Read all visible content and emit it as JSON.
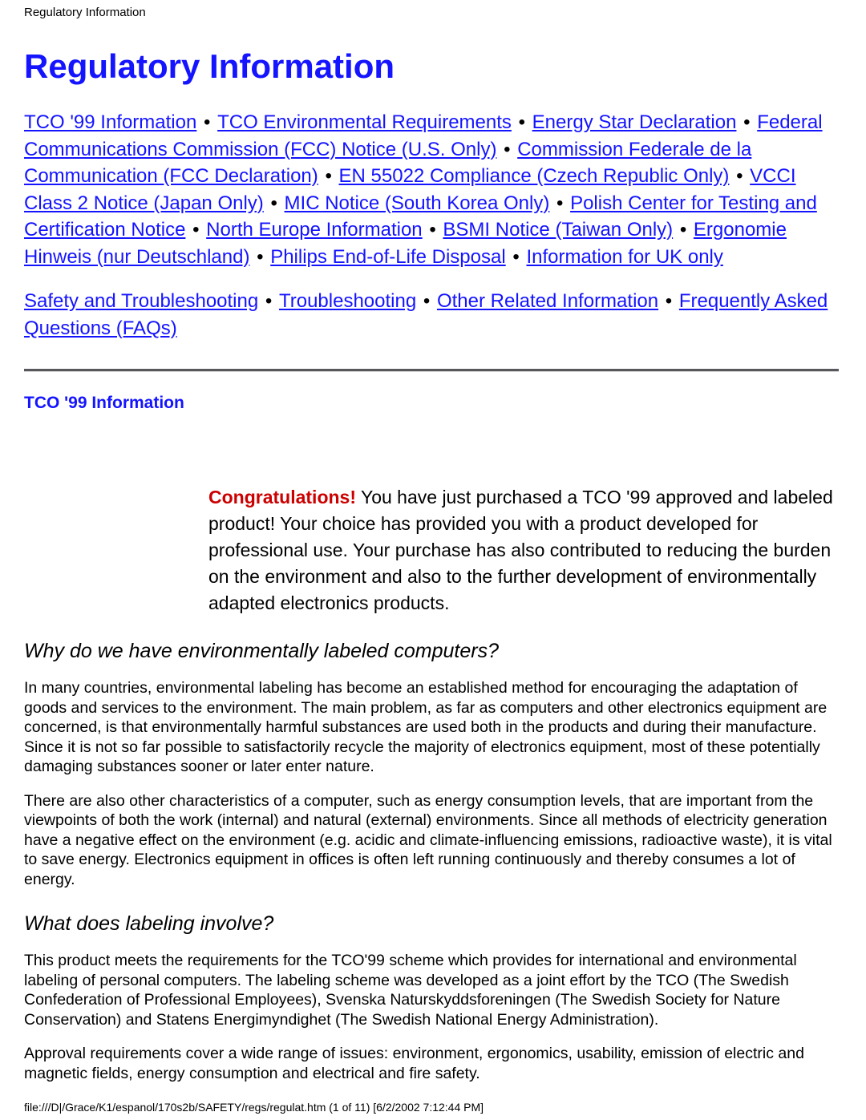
{
  "document": {
    "header_note": "Regulatory Information",
    "title": "Regulatory Information",
    "colors": {
      "link": "#1414ff",
      "heading": "#1414ff",
      "congratulations": "#cc0000",
      "rule": "#58585c",
      "background": "#ffffff",
      "text": "#000000"
    }
  },
  "nav": {
    "separator": "•",
    "group_one": [
      "TCO '99 Information",
      "TCO Environmental Requirements",
      "Energy Star Declaration",
      "Federal Communications Commission (FCC) Notice (U.S. Only)",
      "Commission Federale de la Communication (FCC Declaration)",
      "EN 55022 Compliance (Czech Republic Only)",
      "VCCI Class 2 Notice (Japan Only)",
      "MIC Notice (South Korea Only)",
      "Polish Center for Testing and Certification Notice",
      "North Europe Information",
      "BSMI Notice (Taiwan Only)",
      "Ergonomie Hinweis (nur Deutschland)",
      "Philips End-of-Life Disposal",
      "Information for UK only"
    ],
    "group_two": [
      "Safety and Troubleshooting",
      "Troubleshooting",
      "Other Related Information",
      "Frequently Asked Questions (FAQs)"
    ]
  },
  "section": {
    "heading": "TCO '99 Information",
    "congratulations_label": "Congratulations!",
    "congratulations_body": " You have just purchased a TCO '99 approved and labeled product! Your choice has provided you with a product developed for professional use. Your purchase has also contributed to reducing the burden on the environment and also to the further development of environmentally adapted electronics products.",
    "subsections": [
      {
        "heading": "Why do we have environmentally labeled computers?",
        "paragraphs": [
          "In many countries, environmental labeling has become an established method for encouraging the adaptation of goods and services to the environment. The main problem, as far as computers and other electronics equipment are concerned, is that environmentally harmful substances are used both in the products and during their manufacture. Since it is not so far possible to satisfactorily recycle the majority of electronics equipment, most of these potentially damaging substances sooner or later enter nature.",
          "There are also other characteristics of a computer, such as energy consumption levels, that are important from the viewpoints of both the work (internal) and natural (external) environments. Since all methods of electricity generation have a negative effect on the environment (e.g. acidic and climate-influencing emissions, radioactive waste), it is vital to save energy. Electronics equipment in offices is often left running continuously and thereby consumes a lot of energy."
        ]
      },
      {
        "heading": "What does labeling involve?",
        "paragraphs": [
          "This product meets the requirements for the TCO'99 scheme which provides for international and environmental labeling of personal computers. The labeling scheme was developed as a joint effort by the TCO (The Swedish Confederation of Professional Employees), Svenska Naturskyddsforeningen (The Swedish Society for Nature Conservation) and Statens Energimyndighet (The Swedish National Energy Administration).",
          "Approval requirements cover a wide range of issues: environment, ergonomics, usability, emission of electric and magnetic fields, energy consumption and electrical and fire safety."
        ]
      }
    ]
  },
  "footer": {
    "status": "file:///D|/Grace/K1/espanol/170s2b/SAFETY/regs/regulat.htm (1 of 11) [6/2/2002 7:12:44 PM]"
  }
}
